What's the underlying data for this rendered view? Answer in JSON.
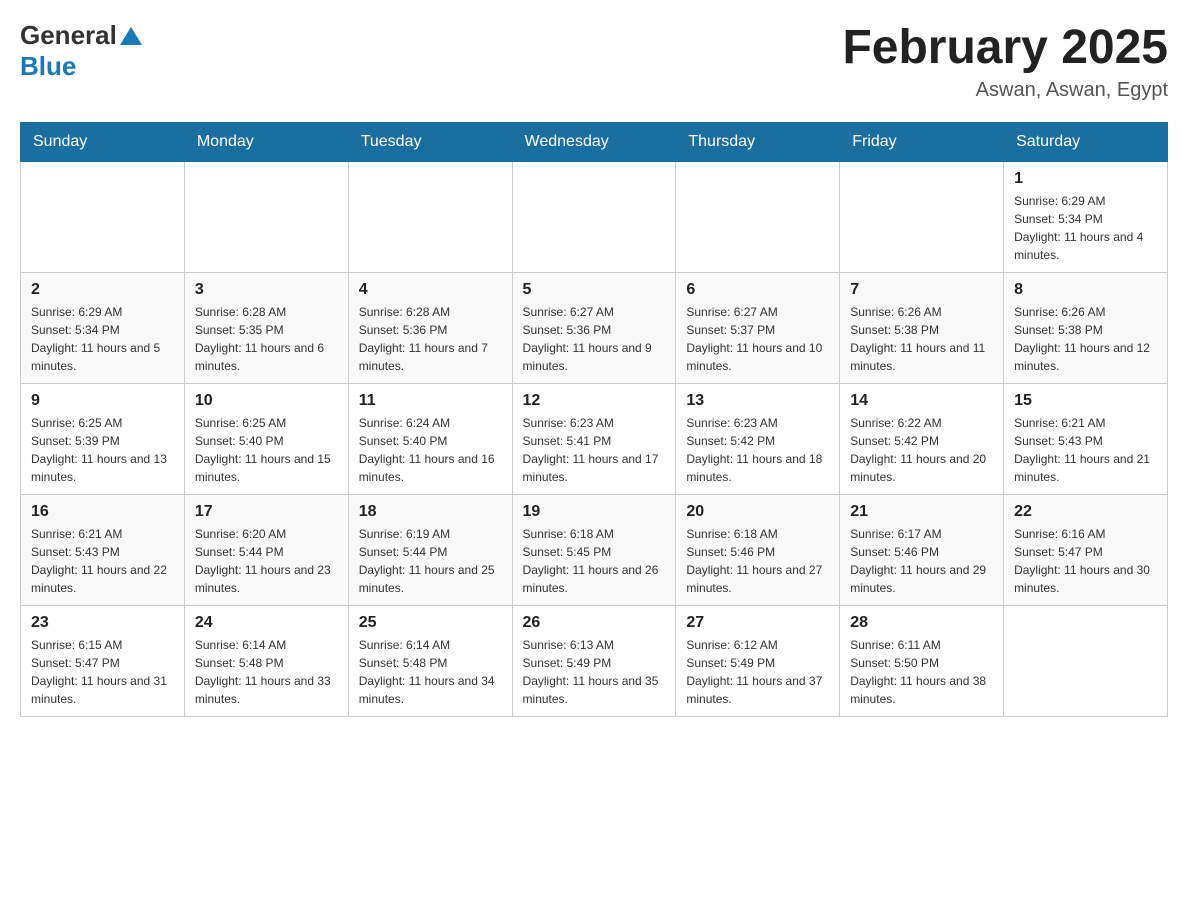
{
  "header": {
    "logo_general": "General",
    "logo_blue": "Blue",
    "month_title": "February 2025",
    "location": "Aswan, Aswan, Egypt"
  },
  "weekdays": [
    "Sunday",
    "Monday",
    "Tuesday",
    "Wednesday",
    "Thursday",
    "Friday",
    "Saturday"
  ],
  "weeks": [
    [
      {
        "day": "",
        "info": ""
      },
      {
        "day": "",
        "info": ""
      },
      {
        "day": "",
        "info": ""
      },
      {
        "day": "",
        "info": ""
      },
      {
        "day": "",
        "info": ""
      },
      {
        "day": "",
        "info": ""
      },
      {
        "day": "1",
        "info": "Sunrise: 6:29 AM\nSunset: 5:34 PM\nDaylight: 11 hours and 4 minutes."
      }
    ],
    [
      {
        "day": "2",
        "info": "Sunrise: 6:29 AM\nSunset: 5:34 PM\nDaylight: 11 hours and 5 minutes."
      },
      {
        "day": "3",
        "info": "Sunrise: 6:28 AM\nSunset: 5:35 PM\nDaylight: 11 hours and 6 minutes."
      },
      {
        "day": "4",
        "info": "Sunrise: 6:28 AM\nSunset: 5:36 PM\nDaylight: 11 hours and 7 minutes."
      },
      {
        "day": "5",
        "info": "Sunrise: 6:27 AM\nSunset: 5:36 PM\nDaylight: 11 hours and 9 minutes."
      },
      {
        "day": "6",
        "info": "Sunrise: 6:27 AM\nSunset: 5:37 PM\nDaylight: 11 hours and 10 minutes."
      },
      {
        "day": "7",
        "info": "Sunrise: 6:26 AM\nSunset: 5:38 PM\nDaylight: 11 hours and 11 minutes."
      },
      {
        "day": "8",
        "info": "Sunrise: 6:26 AM\nSunset: 5:38 PM\nDaylight: 11 hours and 12 minutes."
      }
    ],
    [
      {
        "day": "9",
        "info": "Sunrise: 6:25 AM\nSunset: 5:39 PM\nDaylight: 11 hours and 13 minutes."
      },
      {
        "day": "10",
        "info": "Sunrise: 6:25 AM\nSunset: 5:40 PM\nDaylight: 11 hours and 15 minutes."
      },
      {
        "day": "11",
        "info": "Sunrise: 6:24 AM\nSunset: 5:40 PM\nDaylight: 11 hours and 16 minutes."
      },
      {
        "day": "12",
        "info": "Sunrise: 6:23 AM\nSunset: 5:41 PM\nDaylight: 11 hours and 17 minutes."
      },
      {
        "day": "13",
        "info": "Sunrise: 6:23 AM\nSunset: 5:42 PM\nDaylight: 11 hours and 18 minutes."
      },
      {
        "day": "14",
        "info": "Sunrise: 6:22 AM\nSunset: 5:42 PM\nDaylight: 11 hours and 20 minutes."
      },
      {
        "day": "15",
        "info": "Sunrise: 6:21 AM\nSunset: 5:43 PM\nDaylight: 11 hours and 21 minutes."
      }
    ],
    [
      {
        "day": "16",
        "info": "Sunrise: 6:21 AM\nSunset: 5:43 PM\nDaylight: 11 hours and 22 minutes."
      },
      {
        "day": "17",
        "info": "Sunrise: 6:20 AM\nSunset: 5:44 PM\nDaylight: 11 hours and 23 minutes."
      },
      {
        "day": "18",
        "info": "Sunrise: 6:19 AM\nSunset: 5:44 PM\nDaylight: 11 hours and 25 minutes."
      },
      {
        "day": "19",
        "info": "Sunrise: 6:18 AM\nSunset: 5:45 PM\nDaylight: 11 hours and 26 minutes."
      },
      {
        "day": "20",
        "info": "Sunrise: 6:18 AM\nSunset: 5:46 PM\nDaylight: 11 hours and 27 minutes."
      },
      {
        "day": "21",
        "info": "Sunrise: 6:17 AM\nSunset: 5:46 PM\nDaylight: 11 hours and 29 minutes."
      },
      {
        "day": "22",
        "info": "Sunrise: 6:16 AM\nSunset: 5:47 PM\nDaylight: 11 hours and 30 minutes."
      }
    ],
    [
      {
        "day": "23",
        "info": "Sunrise: 6:15 AM\nSunset: 5:47 PM\nDaylight: 11 hours and 31 minutes."
      },
      {
        "day": "24",
        "info": "Sunrise: 6:14 AM\nSunset: 5:48 PM\nDaylight: 11 hours and 33 minutes."
      },
      {
        "day": "25",
        "info": "Sunrise: 6:14 AM\nSunset: 5:48 PM\nDaylight: 11 hours and 34 minutes."
      },
      {
        "day": "26",
        "info": "Sunrise: 6:13 AM\nSunset: 5:49 PM\nDaylight: 11 hours and 35 minutes."
      },
      {
        "day": "27",
        "info": "Sunrise: 6:12 AM\nSunset: 5:49 PM\nDaylight: 11 hours and 37 minutes."
      },
      {
        "day": "28",
        "info": "Sunrise: 6:11 AM\nSunset: 5:50 PM\nDaylight: 11 hours and 38 minutes."
      },
      {
        "day": "",
        "info": ""
      }
    ]
  ]
}
